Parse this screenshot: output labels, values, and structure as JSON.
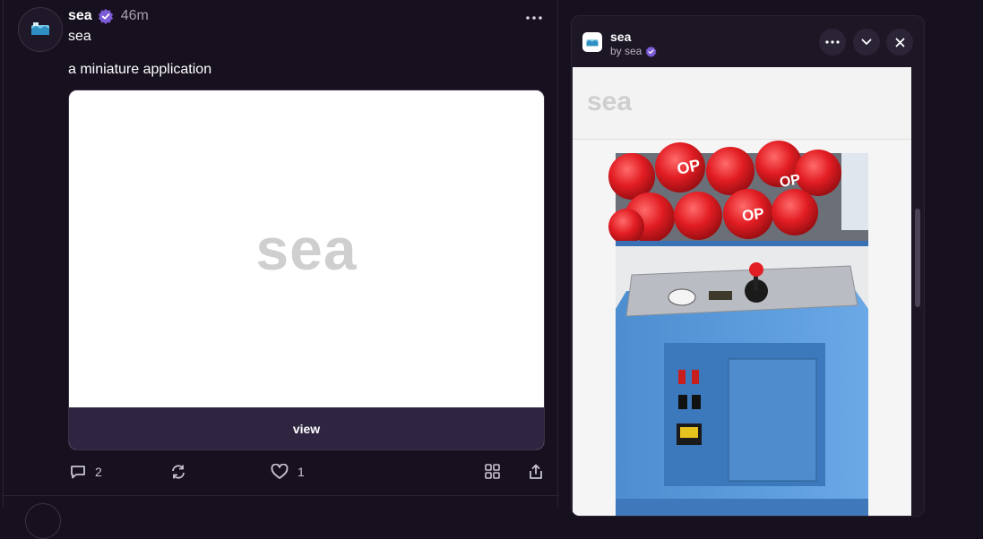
{
  "post": {
    "author": "sea",
    "time": "46m",
    "title": "sea",
    "text": "a miniature application",
    "frame": {
      "logo_text": "sea",
      "button_label": "view"
    },
    "actions": {
      "replies": "2",
      "likes": "1"
    }
  },
  "panel": {
    "title": "sea",
    "byline": "by sea",
    "app": {
      "header_logo": "sea"
    }
  },
  "colors": {
    "background": "#17101f",
    "accent": "#7c5bd6",
    "button": "#2f2540"
  },
  "icons": [
    "sea-avatar-icon",
    "verified-icon",
    "more-icon",
    "reply-icon",
    "recast-icon",
    "like-icon",
    "grid-icon",
    "share-icon",
    "chevron-down-icon",
    "close-icon"
  ]
}
